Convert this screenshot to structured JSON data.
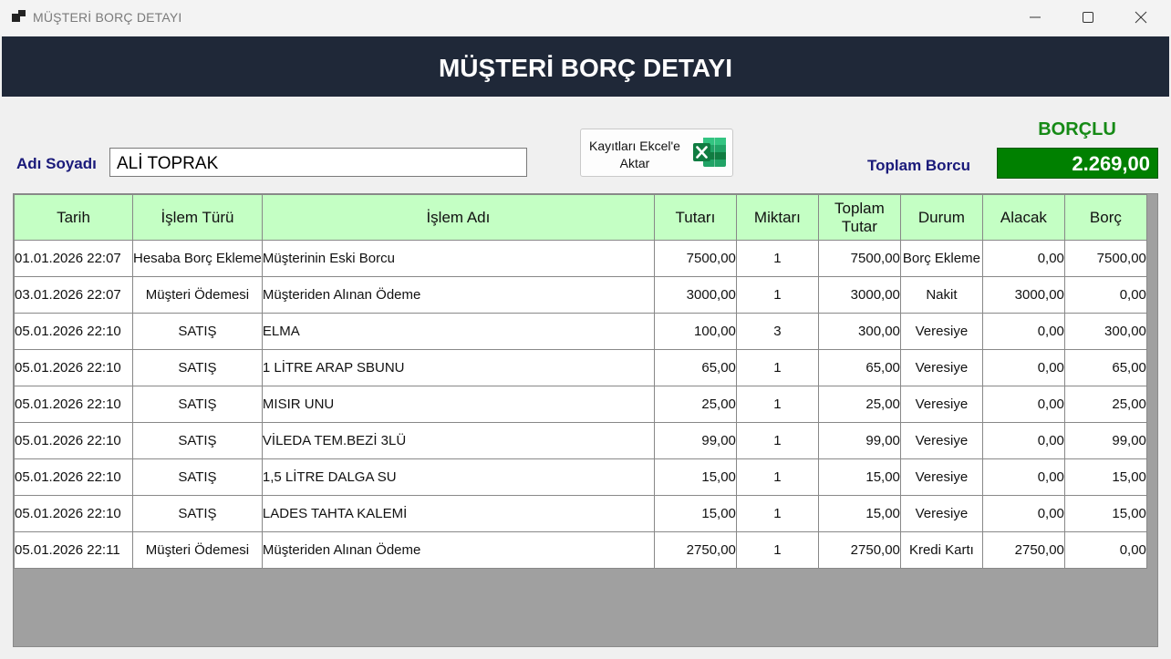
{
  "window": {
    "title": "MÜŞTERİ BORÇ DETAYI"
  },
  "header": {
    "title": "MÜŞTERİ BORÇ DETAYI"
  },
  "customer": {
    "name_label": "Adı Soyadı",
    "name_value": "ALİ TOPRAK"
  },
  "export_button": {
    "label": "Kayıtları Ekcel'e Aktar",
    "icon": "excel-icon"
  },
  "summary": {
    "status": "BORÇLU",
    "total_label": "Toplam Borcu",
    "total_value": "2.269,00",
    "status_color": "#168a16",
    "total_bg": "#008000"
  },
  "table": {
    "header_bg": "#c4ffc4",
    "columns": [
      "Tarih",
      "İşlem Türü",
      "İşlem Adı",
      "Tutarı",
      "Miktarı",
      "Toplam Tutar",
      "Durum",
      "Alacak",
      "Borç"
    ],
    "rows": [
      [
        "01.01.2026 22:07",
        "Hesaba Borç Ekleme",
        "Müşterinin Eski Borcu",
        "7500,00",
        "1",
        "7500,00",
        "Borç Ekleme",
        "0,00",
        "7500,00"
      ],
      [
        "03.01.2026 22:07",
        "Müşteri Ödemesi",
        "Müşteriden Alınan Ödeme",
        "3000,00",
        "1",
        "3000,00",
        "Nakit",
        "3000,00",
        "0,00"
      ],
      [
        "05.01.2026 22:10",
        "SATIŞ",
        "ELMA",
        "100,00",
        "3",
        "300,00",
        "Veresiye",
        "0,00",
        "300,00"
      ],
      [
        "05.01.2026 22:10",
        "SATIŞ",
        "1 LİTRE ARAP SBUNU",
        "65,00",
        "1",
        "65,00",
        "Veresiye",
        "0,00",
        "65,00"
      ],
      [
        "05.01.2026 22:10",
        "SATIŞ",
        "MISIR UNU",
        "25,00",
        "1",
        "25,00",
        "Veresiye",
        "0,00",
        "25,00"
      ],
      [
        "05.01.2026 22:10",
        "SATIŞ",
        "VİLEDA TEM.BEZİ 3LÜ",
        "99,00",
        "1",
        "99,00",
        "Veresiye",
        "0,00",
        "99,00"
      ],
      [
        "05.01.2026 22:10",
        "SATIŞ",
        "1,5 LİTRE DALGA SU",
        "15,00",
        "1",
        "15,00",
        "Veresiye",
        "0,00",
        "15,00"
      ],
      [
        "05.01.2026 22:10",
        "SATIŞ",
        "LADES TAHTA KALEMİ",
        "15,00",
        "1",
        "15,00",
        "Veresiye",
        "0,00",
        "15,00"
      ],
      [
        "05.01.2026 22:11",
        "Müşteri Ödemesi",
        "Müşteriden Alınan Ödeme",
        "2750,00",
        "1",
        "2750,00",
        "Kredi Kartı",
        "2750,00",
        "0,00"
      ]
    ]
  }
}
